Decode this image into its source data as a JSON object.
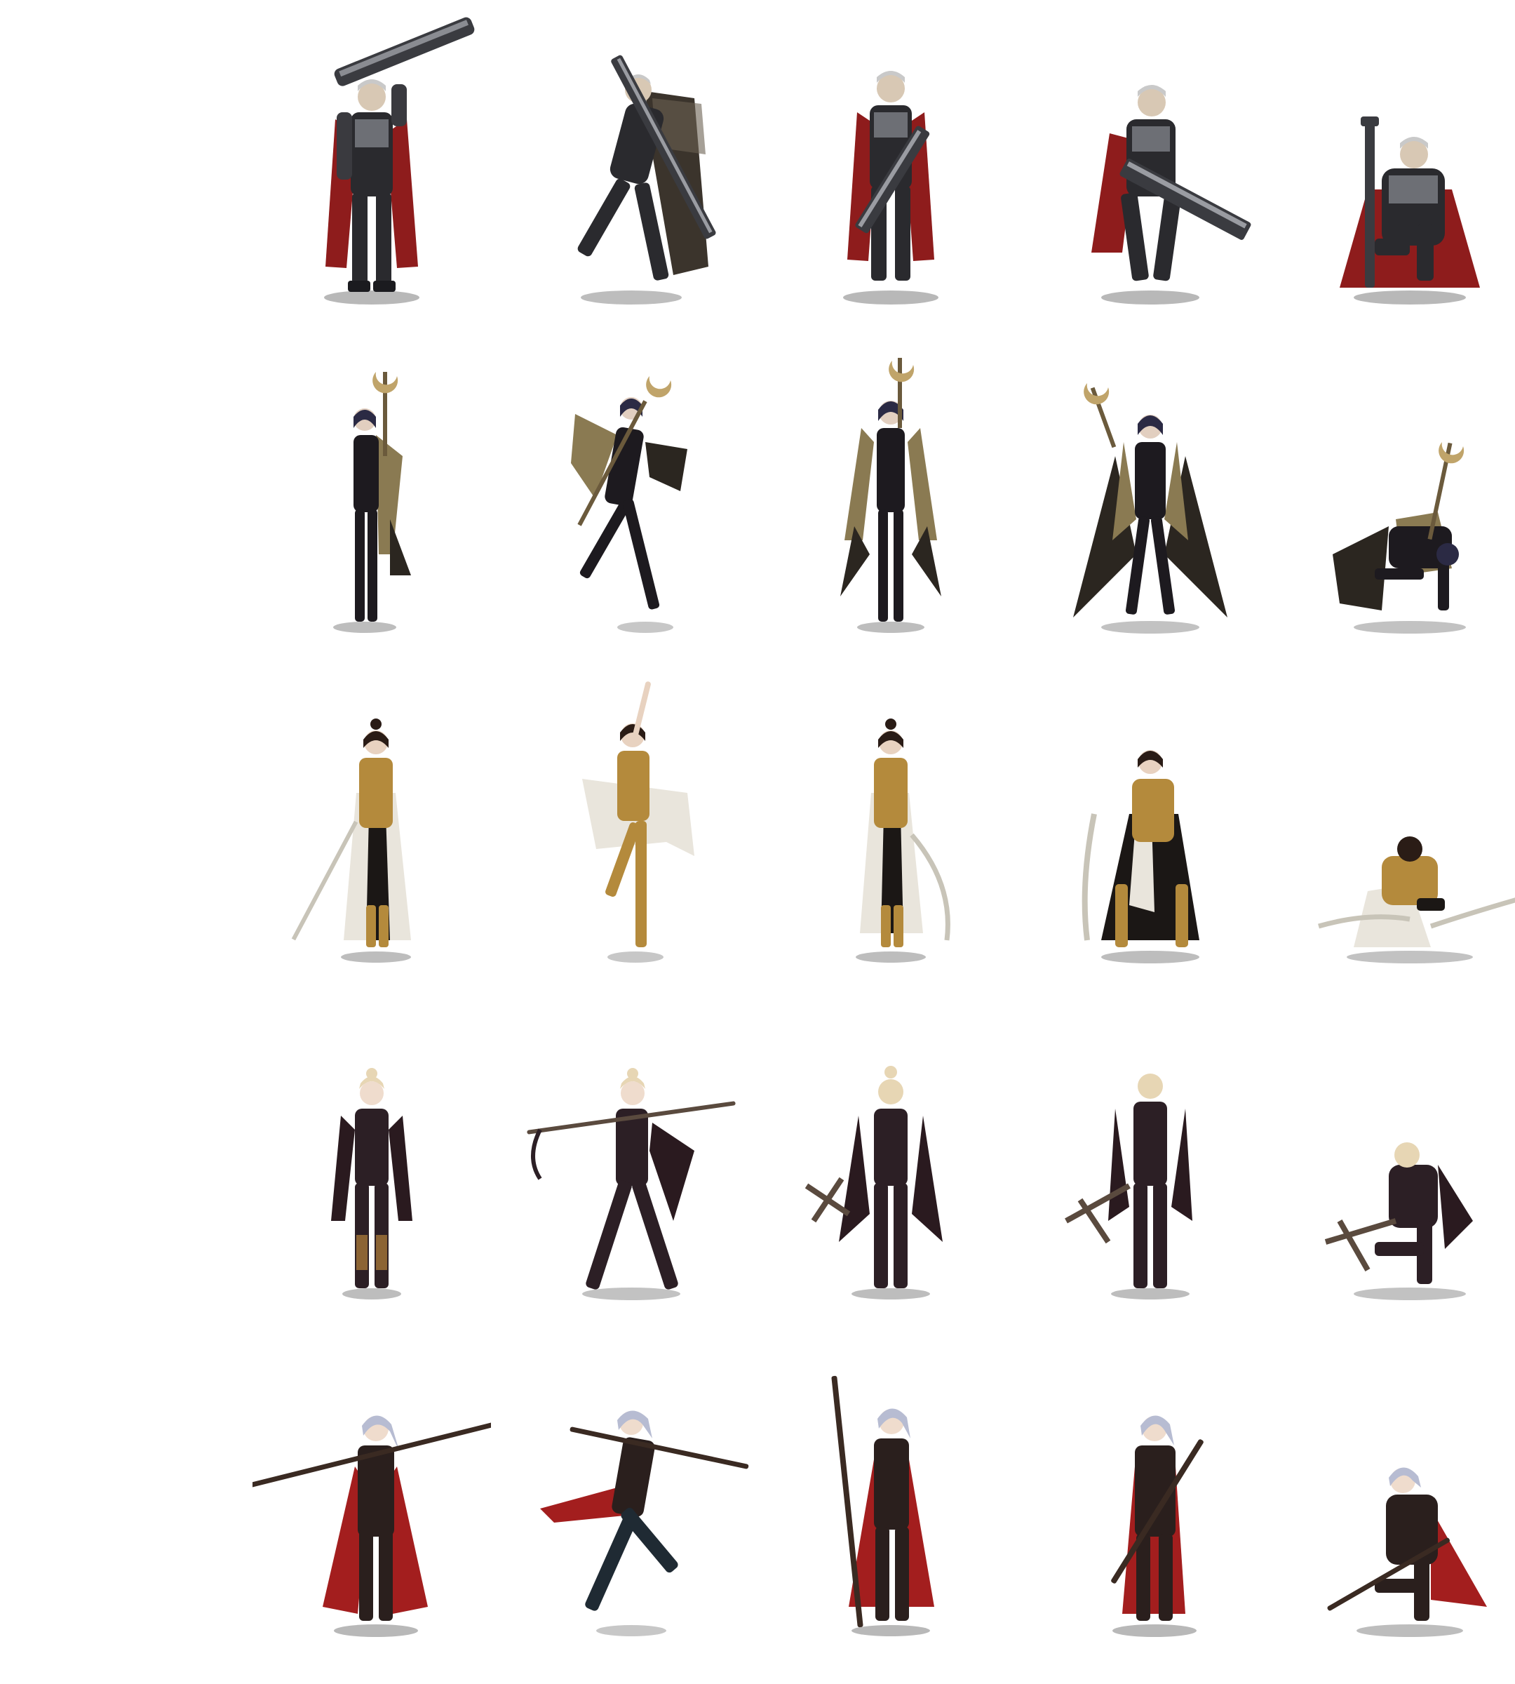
{
  "sheet": {
    "rows": [
      {
        "character": "greatsword-knight",
        "poses": [
          "standing-shoulder-sword",
          "lunging-diagonal-sword",
          "standing-sword-down",
          "crouched-two-hands-sword",
          "kneeling-sword-planted"
        ],
        "colors": {
          "armor": "#2a2a2e",
          "trim": "#6d6f75",
          "cape": "#8e1c1c",
          "hair": "#c9c9c9"
        }
      },
      {
        "character": "crescent-staff-mage",
        "poses": [
          "standing-staff-up",
          "leaping-staff",
          "standing-staff-raised",
          "crouched-staff-over-head",
          "on-knees-staff-up"
        ],
        "colors": {
          "armor": "#1d1a1f",
          "trim": "#8a7a52",
          "cape": "#2b2620",
          "hair": "#2b2a44"
        }
      },
      {
        "character": "white-robed-swordswoman",
        "poses": [
          "standing-sword-low",
          "leaping-arm-raised",
          "standing-sword-side",
          "crouched-sword-ready",
          "kneeling-blades-spread"
        ],
        "colors": {
          "armor": "#b48a3c",
          "trim": "#e9e5dc",
          "cape": "#1b1715",
          "hair": "#2a1c16"
        }
      },
      {
        "character": "blonde-archer",
        "poses": [
          "standing-arms-down",
          "wide-stance-bow-drawn",
          "standing-back-crossbow",
          "standing-back-crossbow-low",
          "kneeling-crossbow"
        ],
        "colors": {
          "armor": "#2c1f25",
          "trim": "#8c6434",
          "cape": "#2a1a1f",
          "hair": "#e7d6b4"
        }
      },
      {
        "character": "red-coat-lancer",
        "poses": [
          "standing-spear-shoulder",
          "running-spear-out",
          "standing-spear-vertical",
          "standing-spear-diagonal",
          "kneeling-spear"
        ],
        "colors": {
          "armor": "#2a1f1d",
          "trim": "#a17a45",
          "cape": "#a31e1e",
          "hair": "#b7bcd2"
        }
      }
    ]
  }
}
